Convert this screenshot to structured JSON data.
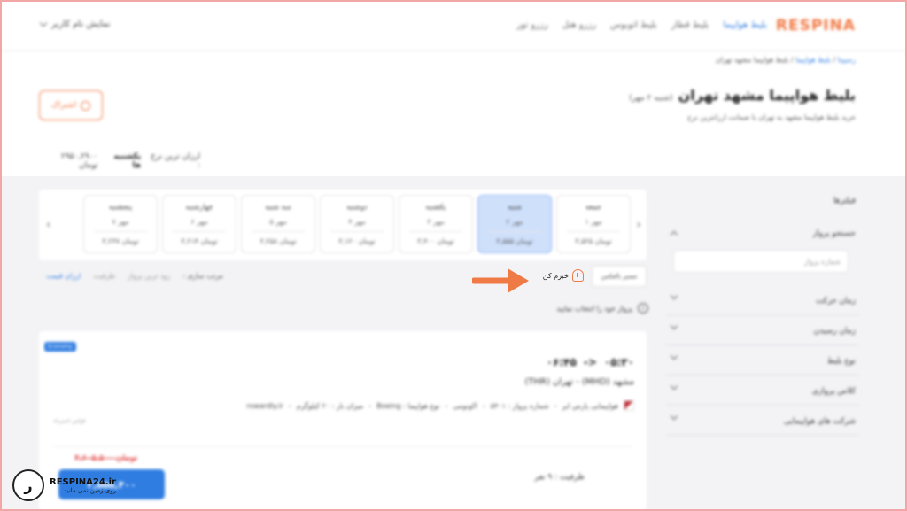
{
  "header": {
    "brand": "RESPINA",
    "nav": [
      {
        "label": "بلیط هواپیما",
        "active": true
      },
      {
        "label": "بلیط قطار",
        "active": false
      },
      {
        "label": "بلیط اتوبوس",
        "active": false
      },
      {
        "label": "رزرو هتل",
        "active": false
      },
      {
        "label": "رزرو تور",
        "active": false
      }
    ],
    "user": "نمایش نام کاربر"
  },
  "breadcrumb": {
    "home": "رسپینا",
    "section": "بلیط هواپیما",
    "current": "بلیط هواپیما مشهد تهران"
  },
  "page": {
    "title": "بلیط هواپیما مشهد تهران",
    "title_date": "(شنبه ۲ مهر)",
    "subtitle": "خرید بلیط هواپیما مشهد به تهران با ضمانت ارزانترین نرخ",
    "share_label": "اشتراک",
    "cheapest_label": "ارزان ترین نرخ :",
    "cheapest_day": "یکشنبه ها",
    "cheapest_price": "۲۹۵۰,۲۹۰۰ تومان"
  },
  "dates": [
    {
      "name": "جمعه",
      "date": "۱ مهر",
      "price": "۳,۵۲۵ تومان",
      "active": false
    },
    {
      "name": "شنبه",
      "date": "۲ مهر",
      "price": "۳,۵۵۵ تومان",
      "active": true
    },
    {
      "name": "یکشنبه",
      "date": "۳ مهر",
      "price": "۳,۴۰۰ تومان",
      "active": false
    },
    {
      "name": "دوشنبه",
      "date": "۴ مهر",
      "price": "۳,۱۲۰ تومان",
      "active": false
    },
    {
      "name": "سه شنبه",
      "date": "۵ مهر",
      "price": "۳,۲۵۸ تومان",
      "active": false
    },
    {
      "name": "چهارشنبه",
      "date": "۶ مهر",
      "price": "۳,۲۱۴ تومان",
      "active": false
    },
    {
      "name": "پنجشنبه",
      "date": "۷ مهر",
      "price": "۳,۲۳۷ تومان",
      "active": false
    }
  ],
  "options": {
    "route_button": "مسیر بالعکس",
    "notify": "خبرم کن !",
    "sort_label": "مرتب سازی :",
    "sort_options": [
      "زود ترین پرواز",
      "ظرفیت",
      "ارزان قیمت"
    ],
    "choose_flight": "پرواز خود را انتخاب نمایید"
  },
  "flight": {
    "badge": "Economy",
    "depart_time": "۰۵:۳۰",
    "arrow": "<-",
    "arrive_time": "۰۶:۴۵",
    "route": "مشهد (MHD) - تهران (THR)",
    "airline": "هواپیمایی پارس ایر",
    "flight_no": "شماره پرواز : ۵۴۰۱",
    "cabin": "اکونومی",
    "aircraft": "نوع هواپیما : Boeing",
    "baggage": "میزان بار : ۲۰ کیلوگرم",
    "provider": "rowardly.ir",
    "note": "قوانین استرداد",
    "capacity": "ظرفیت : ۹ نفر",
    "old_price": "۳,۶۰۵,۵۰۰ تومان",
    "price": "۳,۵۵۵,۴۰۰"
  },
  "filters": {
    "title": "فیلترها",
    "search_heading": "جستجو پرواز",
    "search_placeholder": "شماره پرواز",
    "items": [
      "زمان حرکت",
      "زمان رسیدن",
      "نوع بلیط",
      "کلاس پروازی",
      "شرکت های هواپیمایی"
    ]
  },
  "watermark": {
    "brand": "RESPINA24.ir",
    "tagline": "روی زمین نمی مانید",
    "logo_letter": "ر"
  },
  "colors": {
    "brand_orange": "#f07a45",
    "accent_blue": "#2f7de1",
    "active_date_bg": "#cfe0fb"
  }
}
